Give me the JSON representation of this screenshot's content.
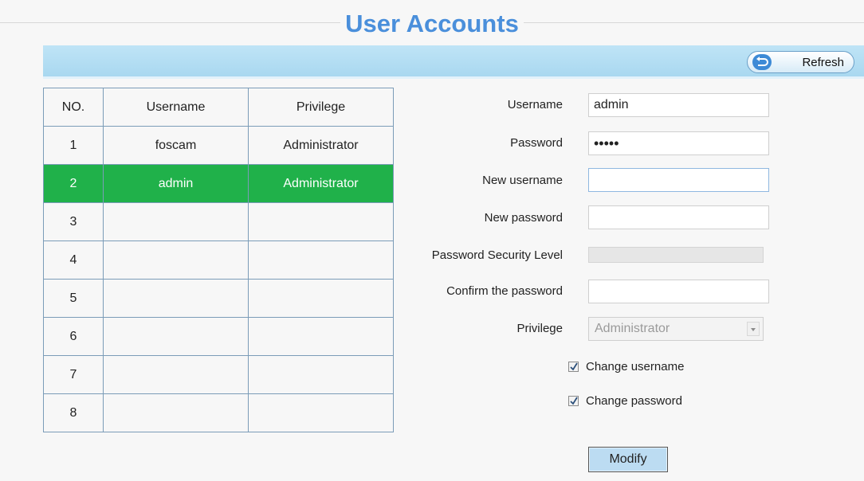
{
  "page": {
    "title": "User Accounts"
  },
  "toolbar": {
    "refresh_label": "Refresh"
  },
  "table": {
    "headers": [
      "NO.",
      "Username",
      "Privilege"
    ],
    "rows": [
      [
        "1",
        "foscam",
        "Administrator"
      ],
      [
        "2",
        "admin",
        "Administrator"
      ],
      [
        "3",
        "",
        ""
      ],
      [
        "4",
        "",
        ""
      ],
      [
        "5",
        "",
        ""
      ],
      [
        "6",
        "",
        ""
      ],
      [
        "7",
        "",
        ""
      ],
      [
        "8",
        "",
        ""
      ]
    ],
    "selected_row": "2",
    "selected_color": "#20b14a"
  },
  "form": {
    "username_label": "Username",
    "username_value": "admin",
    "password_label": "Password",
    "password_value": "•••••",
    "new_username_label": "New username",
    "new_username_value": "",
    "new_password_label": "New password",
    "new_password_value": "",
    "security_label": "Password Security Level",
    "confirm_label": "Confirm the password",
    "confirm_value": "",
    "privilege_label": "Privilege",
    "privilege_value": "Administrator",
    "change_username_label": "Change username",
    "change_username_checked": true,
    "change_password_label": "Change password",
    "change_password_checked": true,
    "modify_label": "Modify"
  },
  "colors": {
    "title": "#4a8fdb",
    "toolbar": "#bfe4f6",
    "button": "#bcdcf2"
  },
  "icons": {
    "refresh": "refresh-icon",
    "check": "check-icon",
    "dropdown": "chevron-down-icon"
  }
}
